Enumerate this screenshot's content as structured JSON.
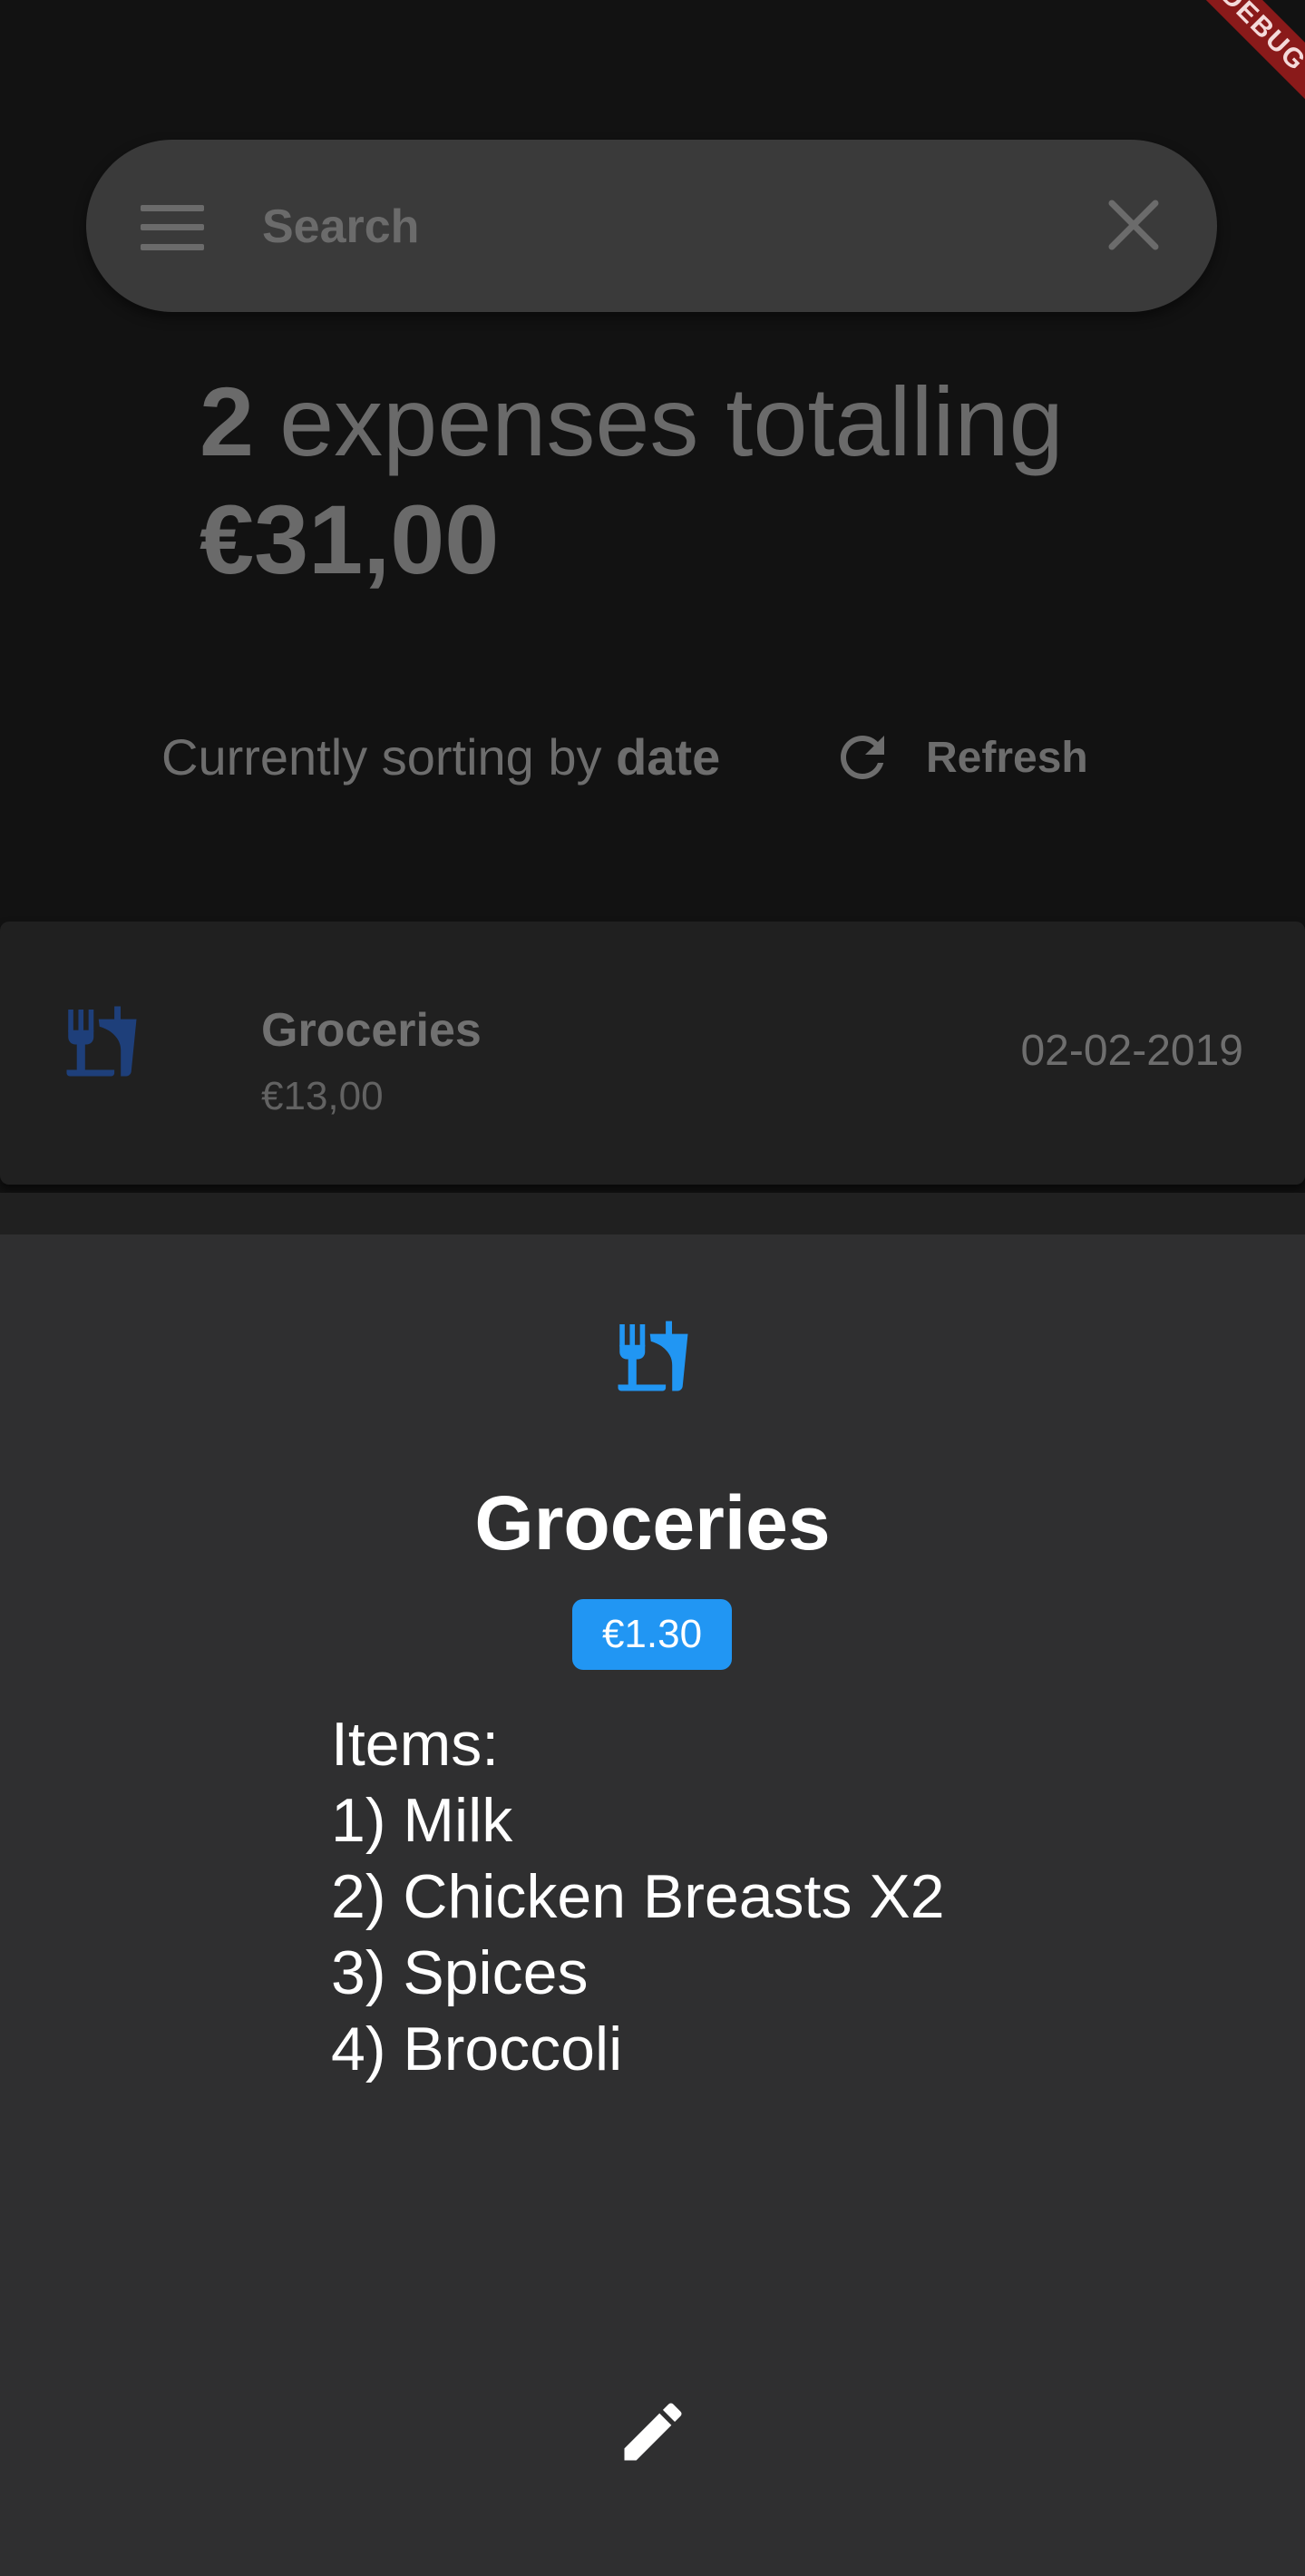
{
  "debug_banner": {
    "label": "DEBUG"
  },
  "search": {
    "placeholder": "Search",
    "value": ""
  },
  "summary": {
    "count": "2",
    "text": "expenses totalling",
    "total": "€31,00"
  },
  "sort": {
    "prefix": "Currently sorting by",
    "key": "date"
  },
  "refresh": {
    "label": "Refresh"
  },
  "expenses": [
    {
      "category_icon": "fork-and-drink-icon",
      "name": "Groceries",
      "amount": "€13,00",
      "date": "02-02-2019"
    }
  ],
  "detail": {
    "category_icon": "fork-and-drink-icon",
    "title": "Groceries",
    "price": "€1.30",
    "notes": {
      "heading": "Items:",
      "items": [
        "1) Milk",
        "2) Chicken Breasts X2",
        "3) Spices",
        "4) Broccoli"
      ]
    },
    "edit_icon": "pencil-icon"
  },
  "colors": {
    "background": "#121212",
    "sheet": "#2f2f30",
    "accent": "#2196f3",
    "list_icon": "#1e3f7a"
  }
}
